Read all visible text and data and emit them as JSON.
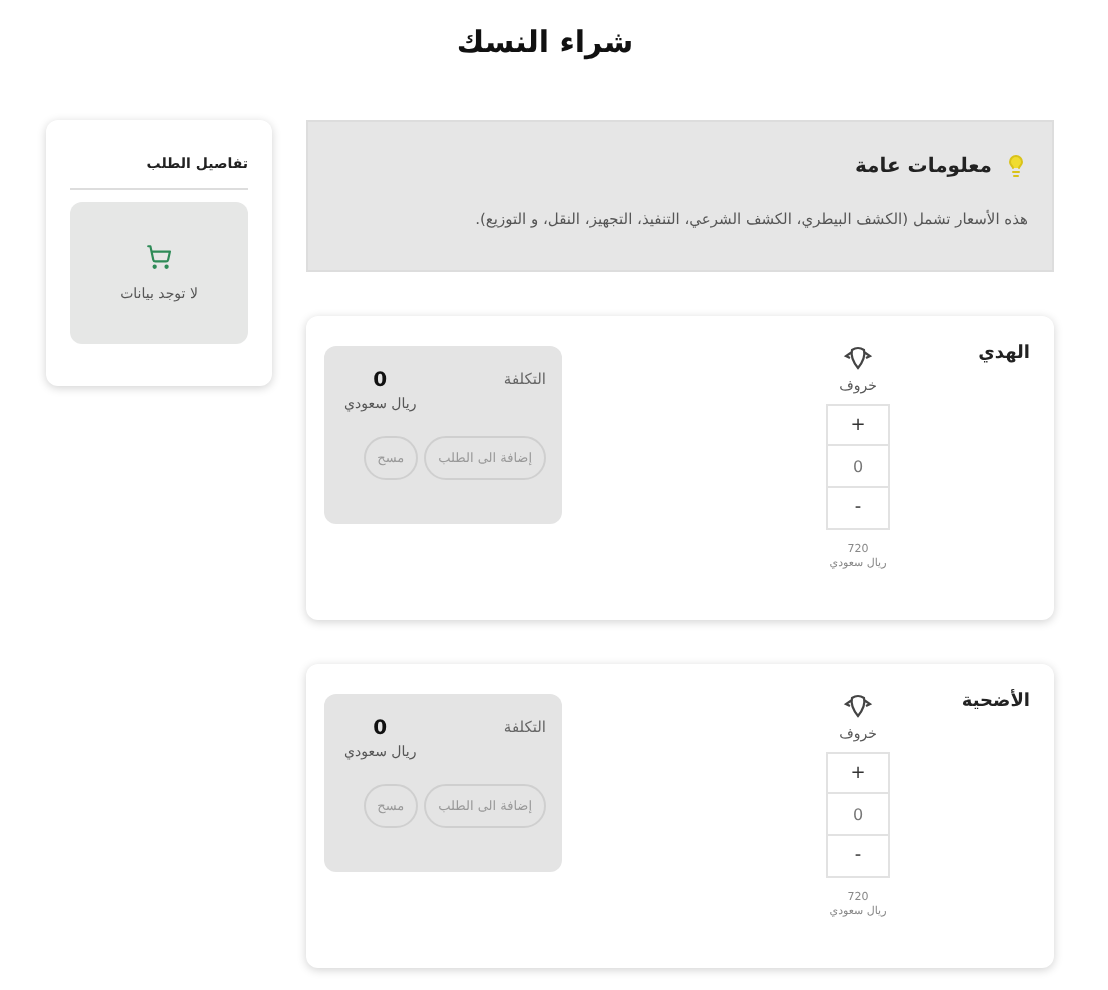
{
  "title": "شراء النسك",
  "order_panel": {
    "title": "تفاصيل الطلب",
    "empty_text": "لا توجد بيانات"
  },
  "info": {
    "title": "معلومات عامة",
    "text": "هذه الأسعار تشمل (الكشف البيطري، الكشف الشرعي، التنفيذ، التجهيز، النقل، و التوزيع)."
  },
  "products": [
    {
      "name": "الهدي",
      "animal": {
        "name": "خروف",
        "plus": "+",
        "quantity": "0",
        "minus": "-",
        "price": "720",
        "currency": "ريال سعودي"
      },
      "cost_label": "التكلفة",
      "cost": "0",
      "cost_currency": "ريال سعودي",
      "buttons": [
        {
          "label": "إضافة الى الطلب",
          "disabled": true
        },
        {
          "label": "مسح",
          "disabled": true
        }
      ]
    },
    {
      "name": "الأضحية",
      "animal": {
        "name": "خروف",
        "plus": "+",
        "quantity": "0",
        "minus": "-",
        "price": "720",
        "currency": "ريال سعودي"
      },
      "cost_label": "التكلفة",
      "cost": "0",
      "cost_currency": "ريال سعودي",
      "buttons": [
        {
          "label": "إضافة الى الطلب",
          "disabled": true
        },
        {
          "label": "مسح",
          "disabled": true
        }
      ]
    }
  ]
}
